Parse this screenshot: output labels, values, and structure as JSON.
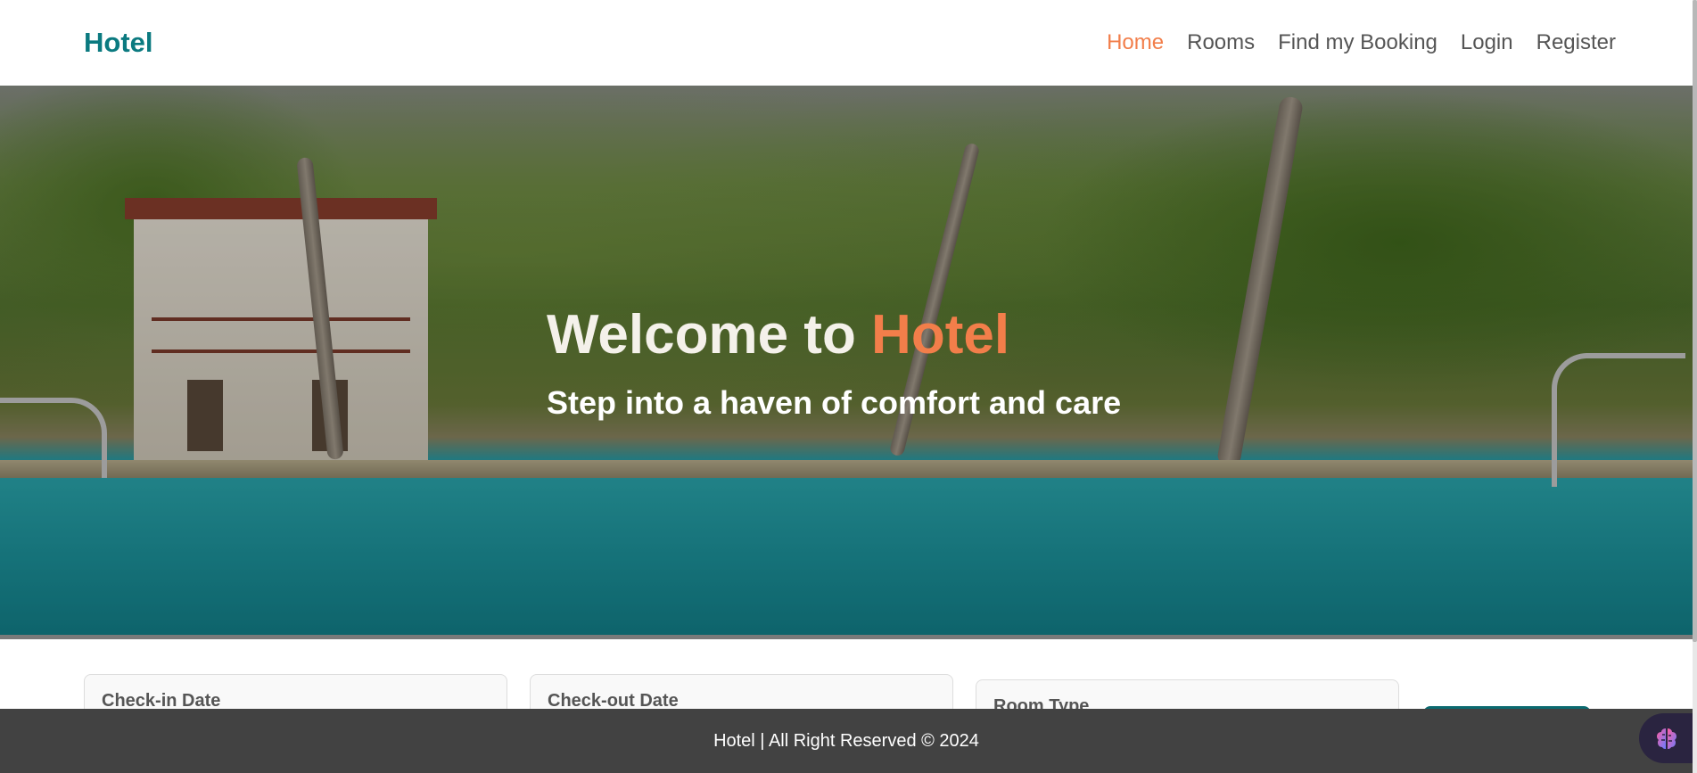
{
  "header": {
    "brand": "Hotel",
    "nav": [
      {
        "label": "Home",
        "active": true
      },
      {
        "label": "Rooms",
        "active": false
      },
      {
        "label": "Find my Booking",
        "active": false
      },
      {
        "label": "Login",
        "active": false
      },
      {
        "label": "Register",
        "active": false
      }
    ]
  },
  "hero": {
    "title_prefix": "Welcome to ",
    "title_accent": "Hotel",
    "subtitle": "Step into a haven of comfort and care"
  },
  "booking": {
    "checkin_label": "Check-in Date",
    "checkout_label": "Check-out Date",
    "room_type_label": "Room Type"
  },
  "footer": {
    "text": "Hotel | All Right Reserved © 2024"
  },
  "widget": {
    "icon": "brain-icon"
  },
  "colors": {
    "brand": "#0b7a80",
    "accent": "#f27e4a",
    "nav_text": "#555555",
    "footer_bg": "#424242"
  }
}
